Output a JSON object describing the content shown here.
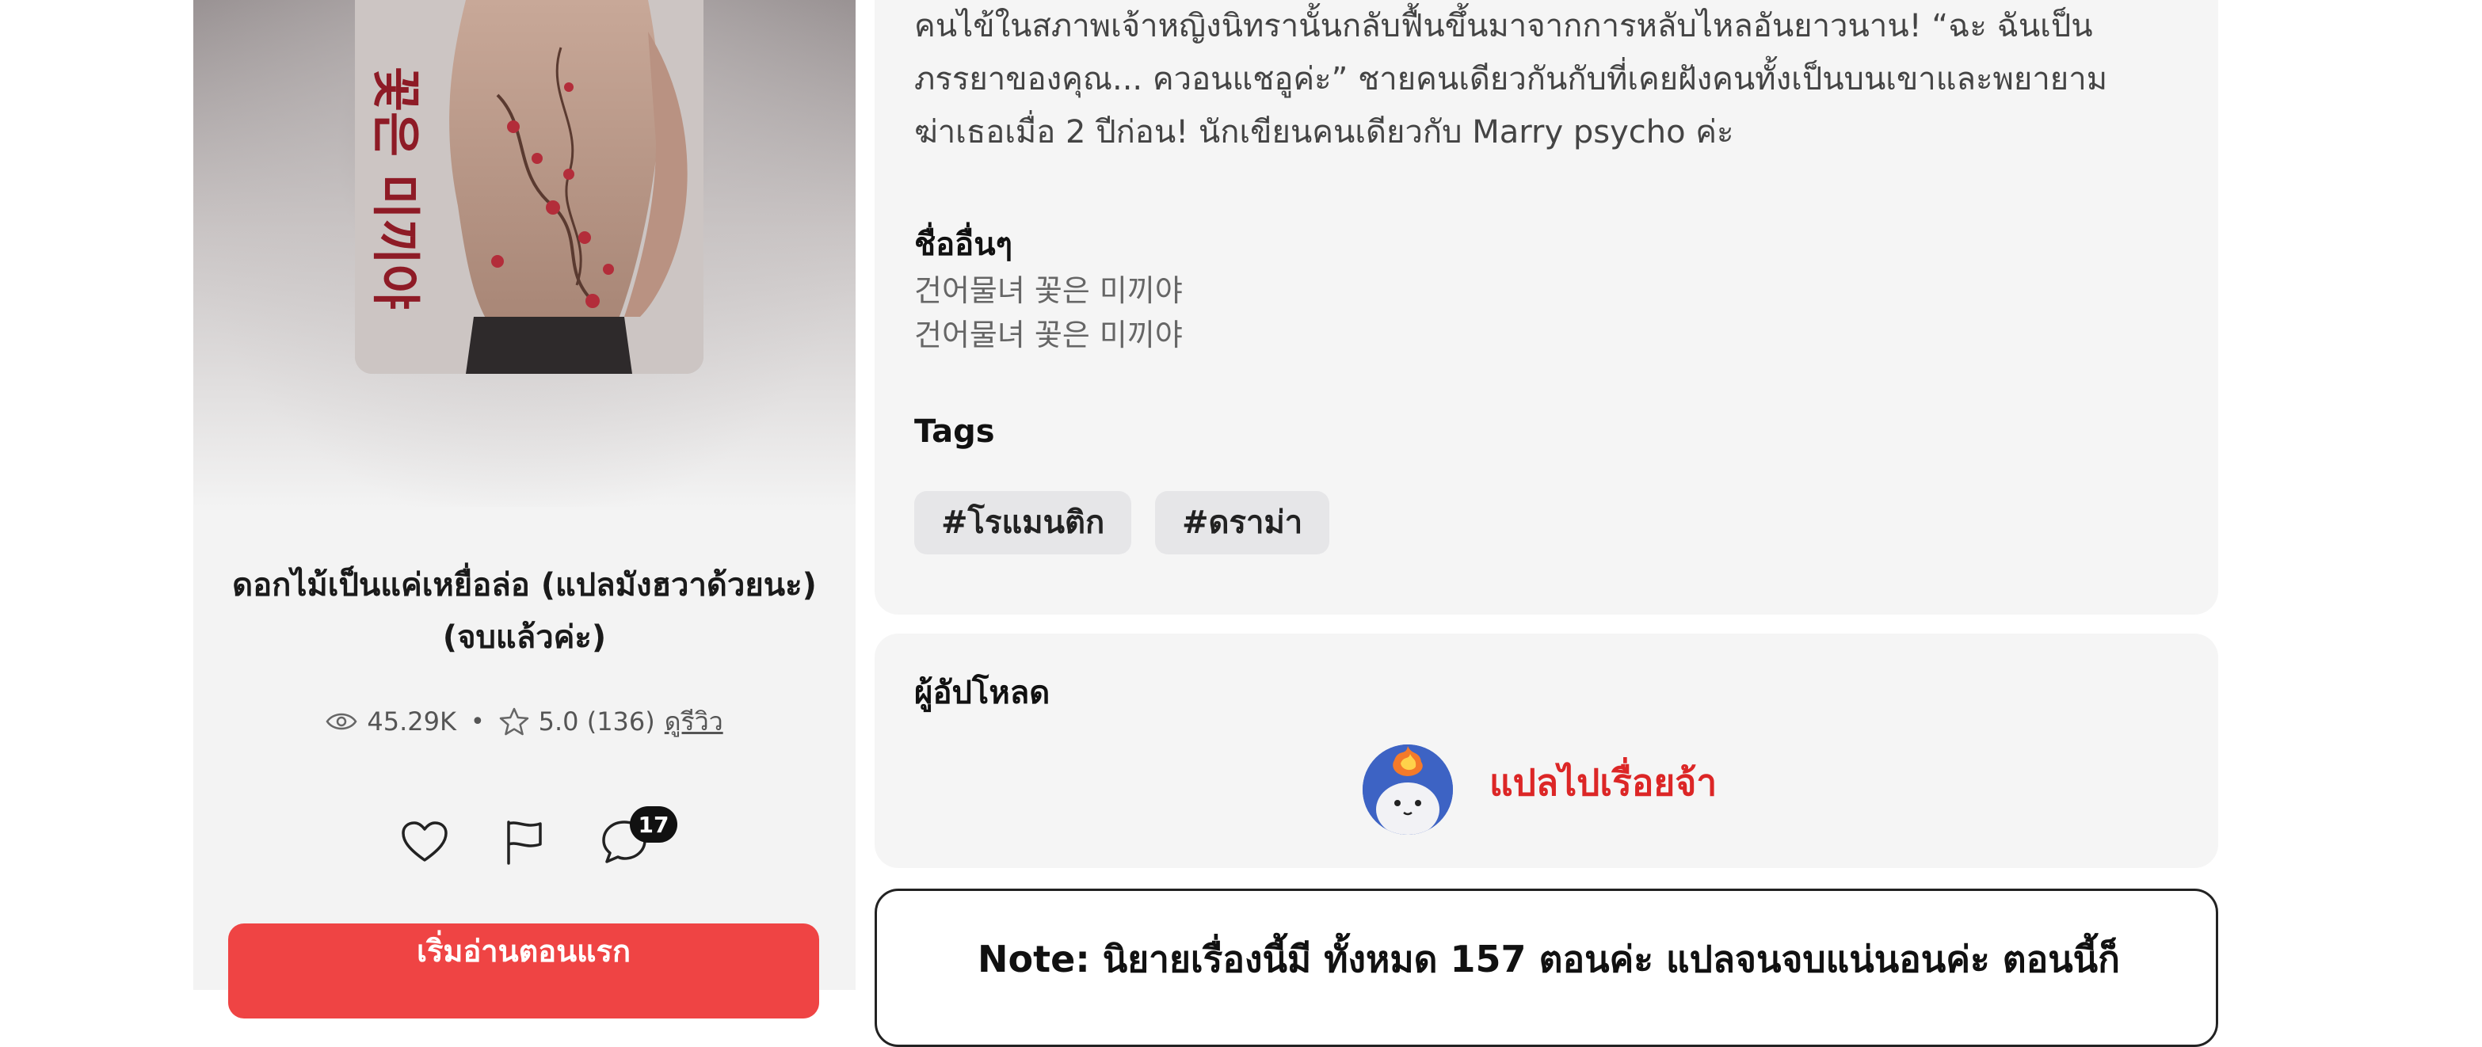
{
  "book": {
    "title": "ดอกไม้เป็นแค่เหยื่อล่อ (แปลมังฮวาด้วยนะ) (จบแล้วค่ะ)",
    "cover_text": "꽃은 미끼야",
    "views": "45.29K",
    "rating": "5.0 (136)",
    "review_link": "ดูรีวิว",
    "comment_count": "17",
    "start_button": "เริ่มอ่านตอนแรก"
  },
  "info": {
    "synopsis_lines": [
      "คนไข้ในสภาพเจ้าหญิงนิทรานั้นกลับฟื้นขึ้นมาจากการหลับไหลอันยาวนาน! “ฉะ ฉันเป็น",
      "ภรรยาของคุณ... ควอนแชอูค่ะ” ชายคนเดียวกันกับที่เคยฝังคนทั้งเป็นบนเขาและพยายาม",
      "ฆ่าเธอเมื่อ 2 ปีก่อน! นักเขียนคนเดียวกับ Marry psycho ค่ะ"
    ],
    "alt_names_heading": "ชื่ออื่นๆ",
    "alt_names": [
      "건어물녀 꽃은 미끼야",
      "건어물녀 꽃은 미끼야"
    ],
    "tags_heading": "Tags",
    "tags": [
      "#โรแมนติก",
      "#ดราม่า"
    ]
  },
  "uploader": {
    "heading": "ผู้อัปโหลด",
    "name": "แปลไปเรื่อยจ้า"
  },
  "note": {
    "text": "Note: นิยายเรื่องนี้มี ทั้งหมด 157 ตอนค่ะ แปลจนจบแน่นอนค่ะ ตอนนี้ก็"
  },
  "colors": {
    "accent_red": "#ef4444",
    "uploader_red": "#dc2626",
    "card_bg": "#f5f5f5",
    "tag_bg": "#e6e6e8"
  },
  "icons": [
    "eye-icon",
    "star-icon",
    "heart-icon",
    "flag-icon",
    "comment-icon"
  ]
}
